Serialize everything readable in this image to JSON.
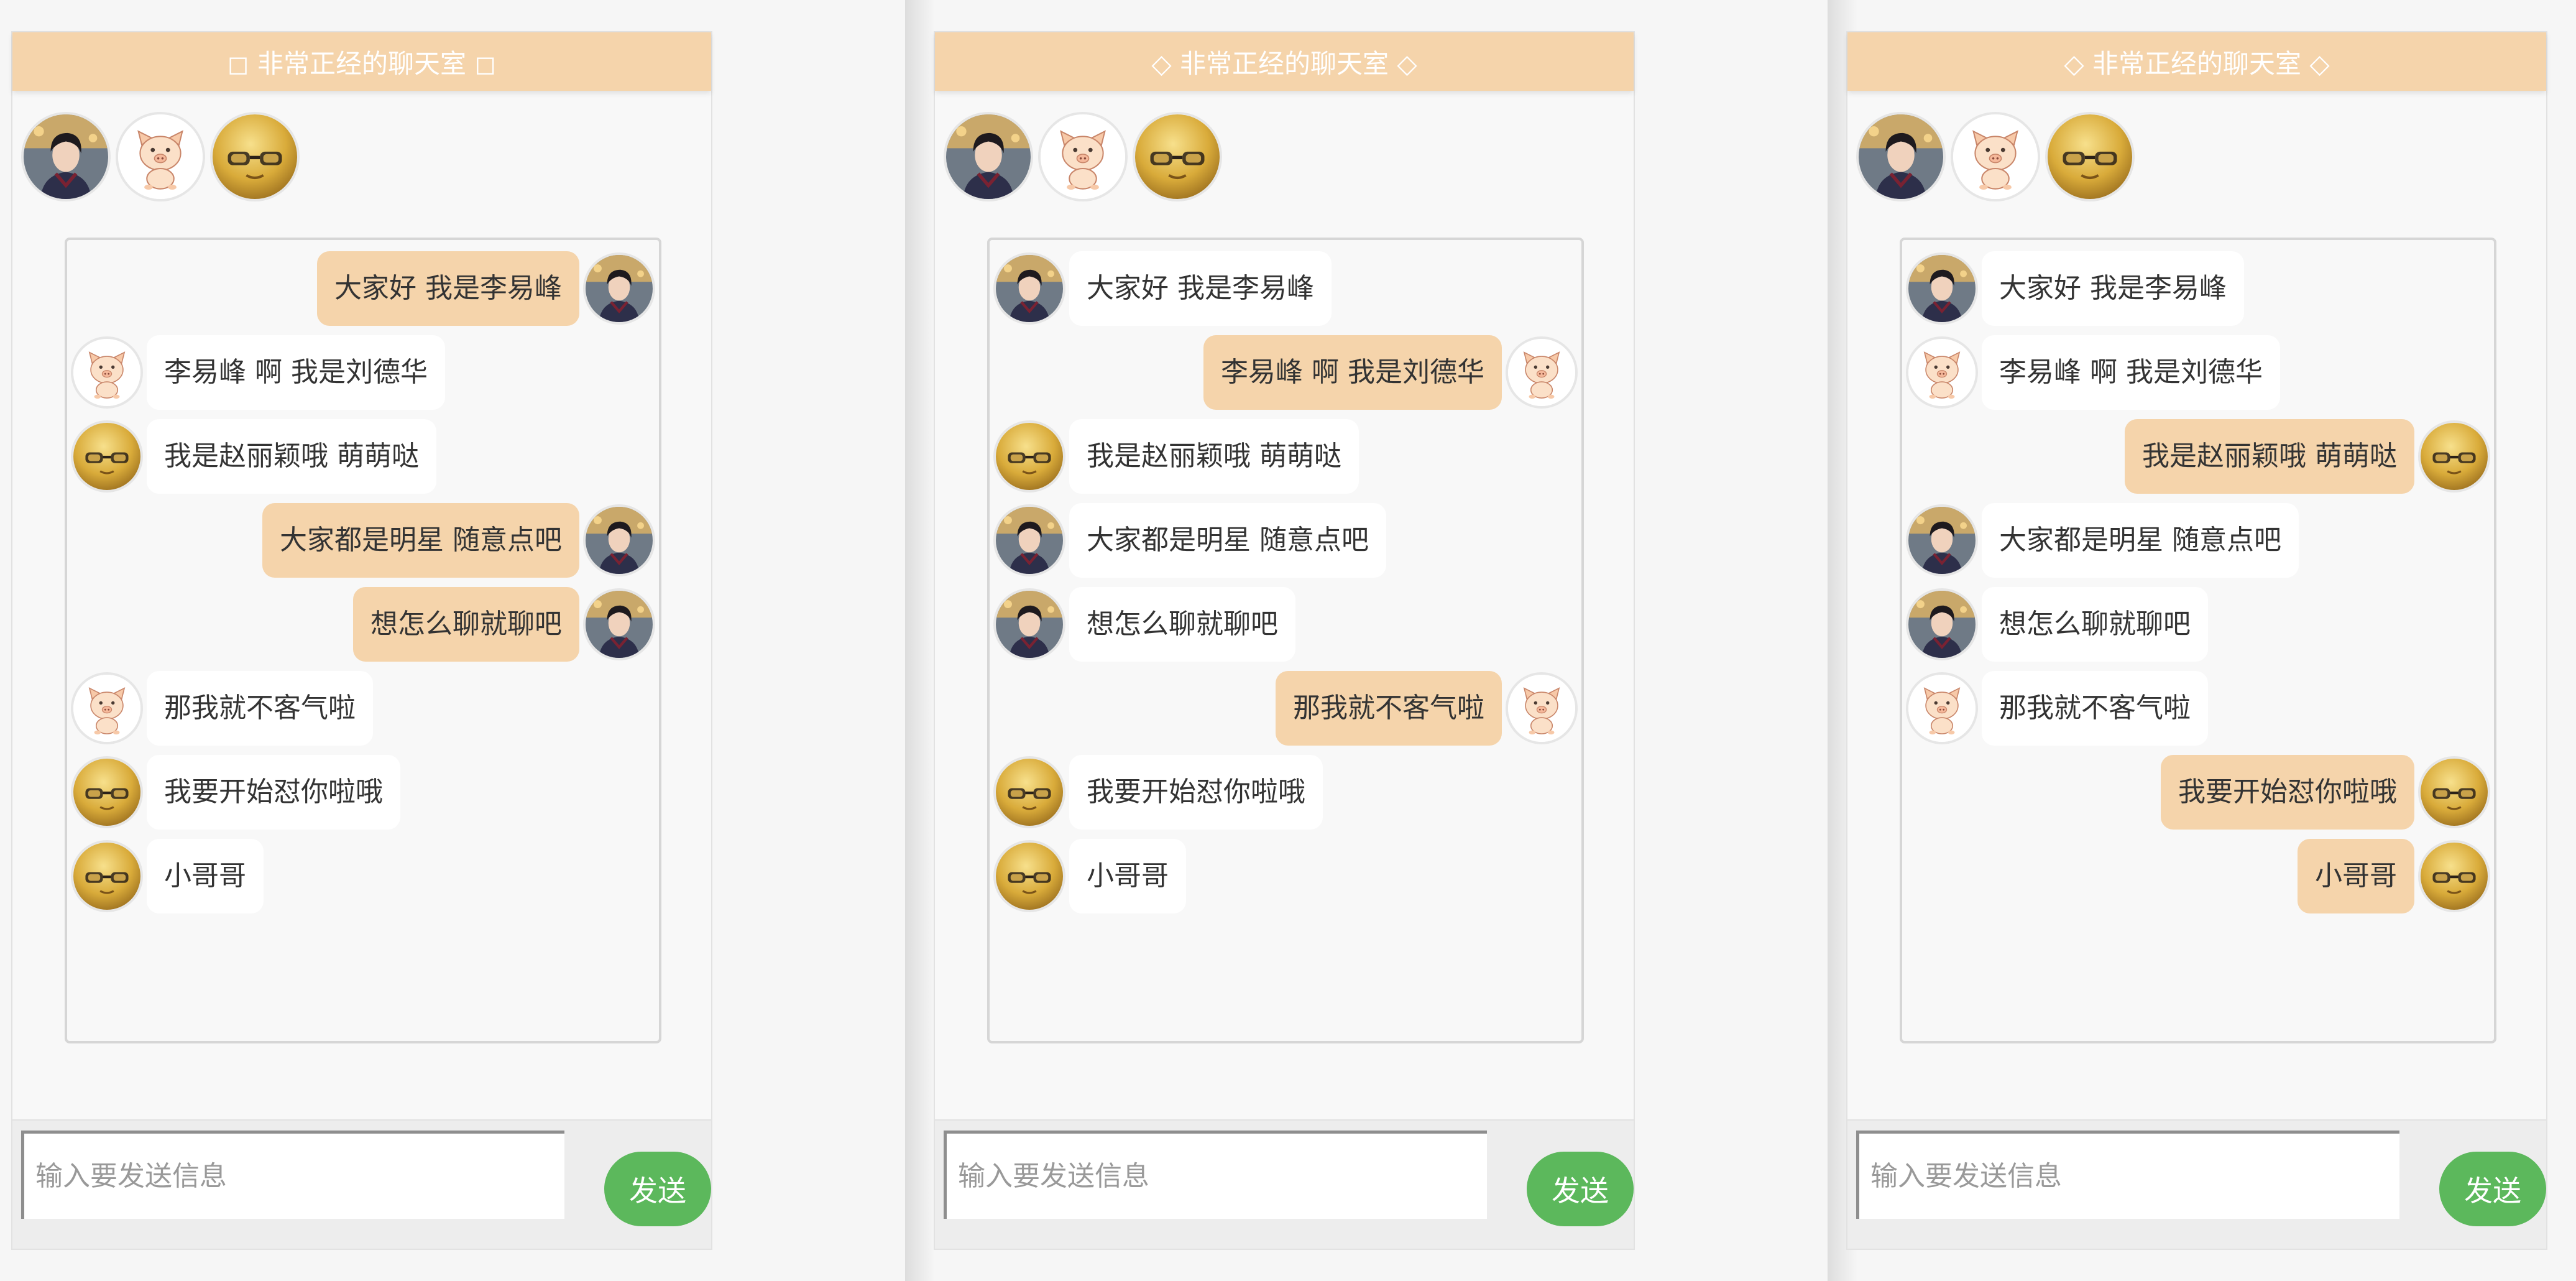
{
  "colors": {
    "accent": "#f5d4ab",
    "send_button": "#5cb85c",
    "panel_background": "#f8f8f8"
  },
  "users": {
    "liyifeng": {
      "avatar_icon": "man-portrait-avatar-icon"
    },
    "liudehua": {
      "avatar_icon": "cartoon-pig-avatar-icon"
    },
    "zhaoliying": {
      "avatar_icon": "yellow-face-glasses-avatar-icon"
    }
  },
  "panels": [
    {
      "title": "◻ 非常正经的聊天室 ◻",
      "input_placeholder": "输入要发送信息",
      "send_label": "发送",
      "messages": [
        {
          "user": "liyifeng",
          "text": "大家好 我是李易峰",
          "self": true
        },
        {
          "user": "liudehua",
          "text": "李易峰 啊 我是刘德华",
          "self": false
        },
        {
          "user": "zhaoliying",
          "text": "我是赵丽颖哦 萌萌哒",
          "self": false
        },
        {
          "user": "liyifeng",
          "text": "大家都是明星 随意点吧",
          "self": true
        },
        {
          "user": "liyifeng",
          "text": "想怎么聊就聊吧",
          "self": true
        },
        {
          "user": "liudehua",
          "text": "那我就不客气啦",
          "self": false
        },
        {
          "user": "zhaoliying",
          "text": "我要开始怼你啦哦",
          "self": false
        },
        {
          "user": "zhaoliying",
          "text": "小哥哥",
          "self": false
        }
      ]
    },
    {
      "title": "◇ 非常正经的聊天室 ◇",
      "input_placeholder": "输入要发送信息",
      "send_label": "发送",
      "messages": [
        {
          "user": "liyifeng",
          "text": "大家好 我是李易峰",
          "self": false
        },
        {
          "user": "liudehua",
          "text": "李易峰 啊 我是刘德华",
          "self": true
        },
        {
          "user": "zhaoliying",
          "text": "我是赵丽颖哦 萌萌哒",
          "self": false
        },
        {
          "user": "liyifeng",
          "text": "大家都是明星 随意点吧",
          "self": false
        },
        {
          "user": "liyifeng",
          "text": "想怎么聊就聊吧",
          "self": false
        },
        {
          "user": "liudehua",
          "text": "那我就不客气啦",
          "self": true
        },
        {
          "user": "zhaoliying",
          "text": "我要开始怼你啦哦",
          "self": false
        },
        {
          "user": "zhaoliying",
          "text": "小哥哥",
          "self": false
        }
      ]
    },
    {
      "title": "◇ 非常正经的聊天室 ◇",
      "input_placeholder": "输入要发送信息",
      "send_label": "发送",
      "messages": [
        {
          "user": "liyifeng",
          "text": "大家好 我是李易峰",
          "self": false
        },
        {
          "user": "liudehua",
          "text": "李易峰 啊 我是刘德华",
          "self": false
        },
        {
          "user": "zhaoliying",
          "text": "我是赵丽颖哦 萌萌哒",
          "self": true
        },
        {
          "user": "liyifeng",
          "text": "大家都是明星 随意点吧",
          "self": false
        },
        {
          "user": "liyifeng",
          "text": "想怎么聊就聊吧",
          "self": false
        },
        {
          "user": "liudehua",
          "text": "那我就不客气啦",
          "self": false
        },
        {
          "user": "zhaoliying",
          "text": "我要开始怼你啦哦",
          "self": true
        },
        {
          "user": "zhaoliying",
          "text": "小哥哥",
          "self": true
        }
      ]
    }
  ]
}
